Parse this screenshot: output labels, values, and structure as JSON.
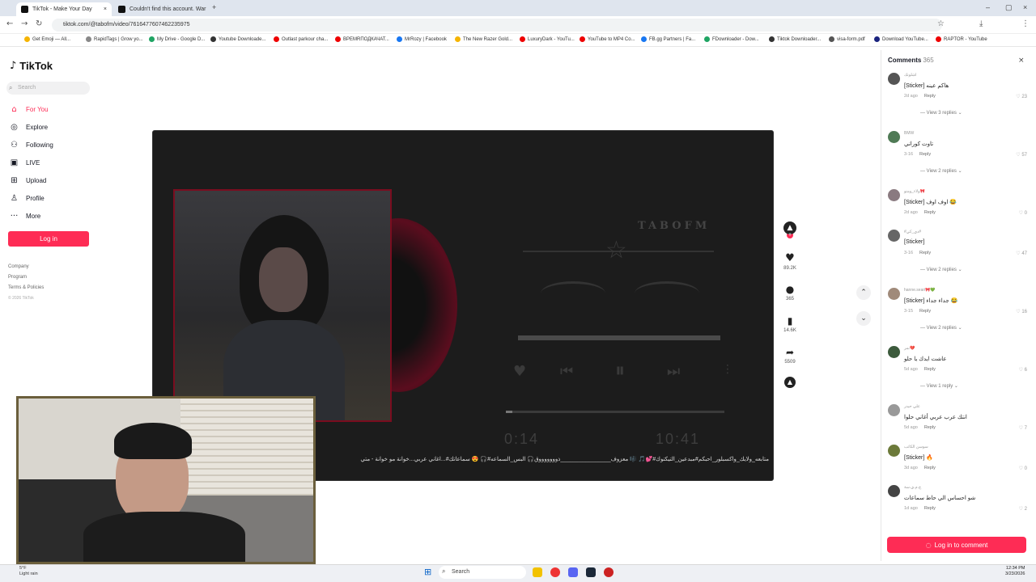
{
  "browser": {
    "tabs": [
      {
        "label": "TikTok - Make Your Day"
      },
      {
        "label": "Couldn't find this account. War"
      }
    ],
    "url": "tiktok.com/@tabofm/video/7616477607462235975",
    "bookmarks": [
      "Get Emoji — All...",
      "RapidTags | Grow yo...",
      "My Drive - Google D...",
      "Youtube Downloade...",
      "Outlast parkour cha...",
      "BPEMRПОДКАЧАТ...",
      "MrRozy | Facebook",
      "The New Razer Gold...",
      "LuxuryDark - YouTu...",
      "YouTube to MP4 Co...",
      "FB.gg Partners | Fa...",
      "FDownloader - Dow...",
      "Tiktok Downloader...",
      "visa-form.pdf",
      "Download YouTube...",
      "RAPTOR - YouTube"
    ]
  },
  "sidebar": {
    "logo": "TikTok",
    "search_placeholder": "Search",
    "items": [
      {
        "label": "For You"
      },
      {
        "label": "Explore"
      },
      {
        "label": "Following"
      },
      {
        "label": "LIVE"
      },
      {
        "label": "Upload"
      },
      {
        "label": "Profile"
      },
      {
        "label": "More"
      }
    ],
    "login": "Log in",
    "footer": [
      "Company",
      "Program",
      "Terms & Policies",
      "© 2026 TikTok"
    ]
  },
  "video": {
    "brand": "TABOFM",
    "elapsed": "0:14",
    "duration": "10:41",
    "caption": "متابعه_ولايك_واكسبلور_احبكم#مبدعين_التيكتوك#💕🎵 🎼 معزوف________________ذوووووووق🎧 البس_السماعه#🎧 😍 سماعاتك#...اغاني عربي...خوانة مو خوانة - متي"
  },
  "actions": {
    "likes": "89.2K",
    "comments": "365",
    "saves": "14.6K",
    "shares": "5509"
  },
  "comments_panel": {
    "title": "Comments",
    "count": "365",
    "login_button": "Log in to comment",
    "comments": [
      {
        "user": "اشلونك",
        "text": "[Sticker] هاكم عينه",
        "meta": "2d ago",
        "reply": "Reply",
        "likes": "23",
        "replies": "View 3 replies"
      },
      {
        "user": "BMW",
        "text": "تاوت كوراني",
        "meta": "3-16",
        "reply": "Reply",
        "likes": "57",
        "replies": "View 2 replies"
      },
      {
        "user": "ولاء_ومنو🎀",
        "text": "[Sticker] اوف اوف 😂",
        "meta": "2d ago",
        "reply": "Reply",
        "likes": "0",
        "replies": ""
      },
      {
        "user": "#دي_كي#",
        "text": "[Sticker]",
        "meta": "3-16",
        "reply": "Reply",
        "likes": "47",
        "replies": "View 2 replies"
      },
      {
        "user": "hanne.seari🎀💚",
        "text": "[Sticker] جداء جداء 😂",
        "meta": "3-15",
        "reply": "Reply",
        "likes": "16",
        "replies": "View 2 replies"
      },
      {
        "user": "نمر💔",
        "text": "عاشت ايدك يا حلو",
        "meta": "5d ago",
        "reply": "Reply",
        "likes": "6",
        "replies": "View 1 reply"
      },
      {
        "user": "علي حيدر",
        "text": "انتك عرب عربي أغاني حلوا",
        "meta": "5d ago",
        "reply": "Reply",
        "likes": "7",
        "replies": ""
      },
      {
        "user": "سوسن الكاتب",
        "text": "[Sticker] 🔥",
        "meta": "3d ago",
        "reply": "Reply",
        "likes": "0",
        "replies": ""
      },
      {
        "user": "ج.م.ي.سة",
        "text": "شو احساس الي حاط سماعات",
        "meta": "1d ago",
        "reply": "Reply",
        "likes": "2",
        "replies": ""
      }
    ]
  },
  "taskbar": {
    "search": "Search",
    "weather_temp": "5°F",
    "weather_desc": "Light rain",
    "time": "12:34 PM",
    "date": "3/23/2026"
  }
}
